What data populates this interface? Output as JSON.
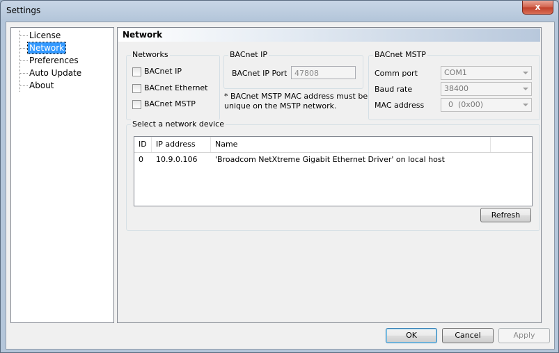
{
  "window": {
    "title": "Settings",
    "close_label": "x"
  },
  "sidebar": {
    "items": [
      {
        "label": "License",
        "selected": false
      },
      {
        "label": "Network",
        "selected": true
      },
      {
        "label": "Preferences",
        "selected": false
      },
      {
        "label": "Auto Update",
        "selected": false
      },
      {
        "label": "About",
        "selected": false
      }
    ]
  },
  "panel": {
    "title": "Network"
  },
  "networks_group": {
    "legend": "Networks",
    "options": [
      {
        "label": "BACnet IP",
        "checked": false
      },
      {
        "label": "BACnet Ethernet",
        "checked": false
      },
      {
        "label": "BACnet MSTP",
        "checked": false
      }
    ]
  },
  "bacnet_ip_group": {
    "legend": "BACnet IP",
    "port_label": "BACnet IP Port",
    "port_value": "47808",
    "note_line1": "* BACnet MSTP MAC address must be",
    "note_line2": "unique on the MSTP network."
  },
  "mstp_group": {
    "legend": "BACnet MSTP",
    "comm_port_label": "Comm port",
    "comm_port_value": "COM1",
    "baud_rate_label": "Baud rate",
    "baud_rate_value": "38400",
    "mac_label": "MAC address",
    "mac_value": "0  (0x00)"
  },
  "device_group": {
    "legend": "Select a network device",
    "columns": [
      "ID",
      "IP address",
      "Name"
    ],
    "rows": [
      {
        "id": "0",
        "ip": "10.9.0.106",
        "name": "'Broadcom NetXtreme Gigabit Ethernet Driver' on local host"
      }
    ],
    "refresh_label": "Refresh"
  },
  "footer": {
    "ok_label": "OK",
    "cancel_label": "Cancel",
    "apply_label": "Apply"
  }
}
